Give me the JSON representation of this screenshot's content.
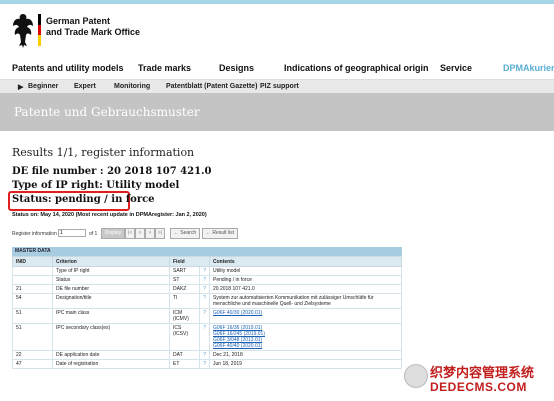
{
  "header": {
    "logo_line1": "German Patent",
    "logo_line2": "and Trade Mark Office"
  },
  "mainnav": [
    "Patents and utility models",
    "Trade marks",
    "Designs",
    "Indications of geographical origin",
    "Service",
    "DPMAkurier"
  ],
  "subnav": [
    "Beginner",
    "Expert",
    "Monitoring",
    "Patentblatt (Patent Gazette)",
    "PIZ support"
  ],
  "banner": {
    "title": "Patente und Gebrauchsmuster"
  },
  "page": {
    "results": "Results 1/1, register information",
    "file_number": "DE file number : 20 2018 107 421.0",
    "ip_type": "Type of IP right: Utility model",
    "status": "Status: pending / in force",
    "status_on": "Status on:  May 14, 2020 (Most recent update in DPMAregister:  Jan 2, 2020)"
  },
  "toolbar": {
    "label": "Register information",
    "input_value": "1",
    "of": "of 1",
    "display": "Display",
    "first": "|<",
    "prev": "<",
    "next": ">",
    "last": ">|",
    "search": "← Search",
    "result_list": "← Result list"
  },
  "master": {
    "heading": "MASTER DATA",
    "columns": [
      "INID",
      "Criterion",
      "Field",
      "Contents"
    ],
    "rows": [
      {
        "inid": "",
        "criterion": "Type of IP right",
        "field": "SART",
        "contents": [
          "Utility model"
        ],
        "links": false
      },
      {
        "inid": "",
        "criterion": "Status",
        "field": "ST",
        "contents": [
          "Pending / in force"
        ],
        "links": false
      },
      {
        "inid": "21",
        "criterion": "DE file number",
        "field": "DAKZ",
        "contents": [
          "20 2018 107 421.0"
        ],
        "links": false
      },
      {
        "inid": "54",
        "criterion": "Designation/title",
        "field": "TI",
        "contents": [
          "System zur automatisierten Kommunikation mit zulässiger Umschläfe für menschliche und maschinelle Quell- und Zielsysteme"
        ],
        "links": false
      },
      {
        "inid": "51",
        "criterion": "IPC main class",
        "field": "ICM\n(ICMV)",
        "contents": [
          "G06F 40/30 (2020.01)"
        ],
        "links": true
      },
      {
        "inid": "51",
        "criterion": "IPC secondary class(es)",
        "field": "ICS\n(ICSV)",
        "contents": [
          "G06F 16/36 (2019.01)",
          "G06F 16/245 (2019.01)",
          "G06F 3/048 (2013.01)",
          "G06F 40/40 (2020.01)"
        ],
        "links": true
      },
      {
        "inid": "22",
        "criterion": "DE application date",
        "field": "DAT",
        "contents": [
          "Dec 21, 2018"
        ],
        "links": false
      },
      {
        "inid": "47",
        "criterion": "Date of registration",
        "field": "ET",
        "contents": [
          "Jun 18, 2019"
        ],
        "links": false
      }
    ]
  },
  "watermark": {
    "line1": "织梦内容管理系统",
    "line2": "DEDECMS.COM"
  },
  "colors": {
    "topbar": "#a6d5e8",
    "banner": "#c4c4c4",
    "status_outline": "#e02020",
    "table_head": "#a9cde0",
    "link": "#1a5fb4"
  }
}
